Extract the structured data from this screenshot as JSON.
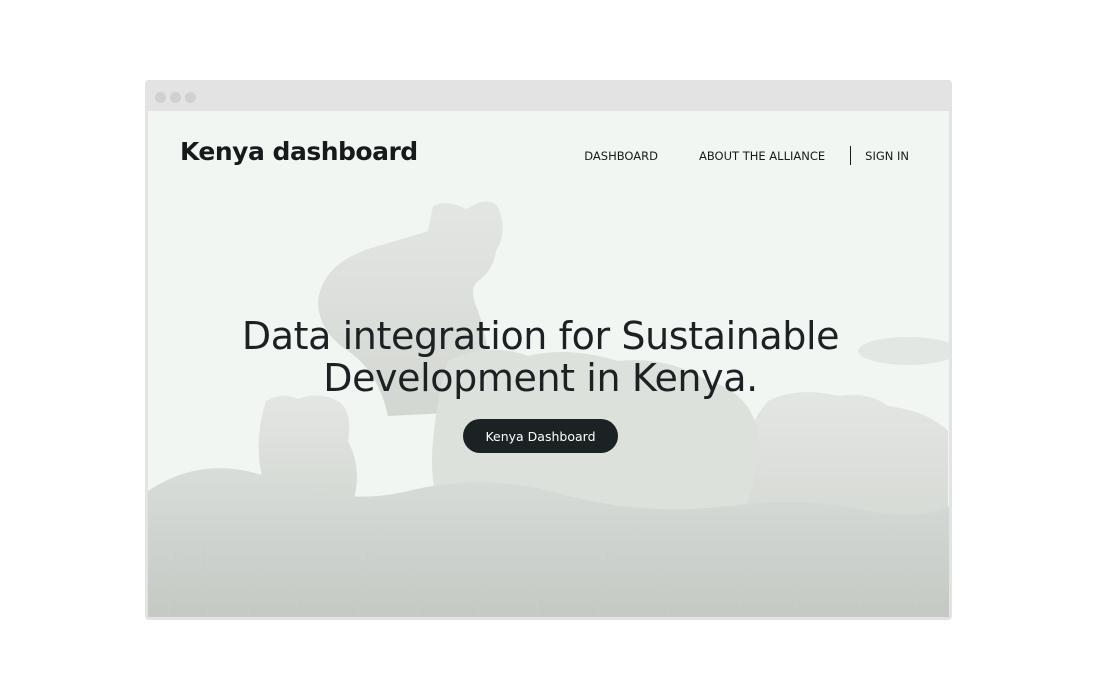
{
  "site": {
    "brand": "Kenya dashboard"
  },
  "nav": {
    "items": [
      {
        "label": "DASHBOARD"
      },
      {
        "label": "ABOUT THE ALLIANCE"
      }
    ],
    "sign_in": "SIGN IN"
  },
  "hero": {
    "headline_line1": "Data integration for Sustainable",
    "headline_line2": "Development in Kenya.",
    "cta_label": "Kenya Dashboard",
    "background_image": "lions-on-grass"
  },
  "colors": {
    "page_background": "#f1f6f2",
    "text": "#161a1b",
    "button": "#1a2223",
    "button_text": "#ffffff"
  }
}
